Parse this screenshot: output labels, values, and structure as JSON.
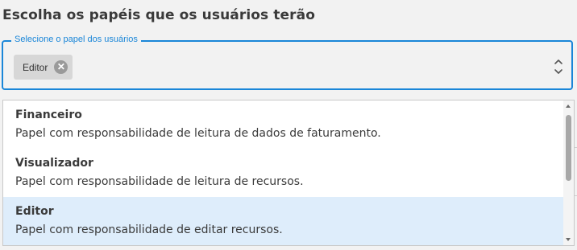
{
  "heading": "Escolha os papéis que os usuários terão",
  "select": {
    "legend": "Selecione o papel dos usuários",
    "chip_label": "Editor",
    "close_glyph": "✕",
    "expand_icon": "up-down-chevron-icon"
  },
  "options": [
    {
      "title": "Financeiro",
      "description": "Papel com responsabilidade de leitura de dados de faturamento.",
      "selected": false
    },
    {
      "title": "Visualizador",
      "description": "Papel com responsabilidade de leitura de recursos.",
      "selected": false
    },
    {
      "title": "Editor",
      "description": "Papel com responsabilidade de editar recursos.",
      "selected": true
    }
  ],
  "colors": {
    "accent": "#1a86d8",
    "selected_bg": "#deedfb",
    "chip_bg": "#d7d7d7"
  }
}
